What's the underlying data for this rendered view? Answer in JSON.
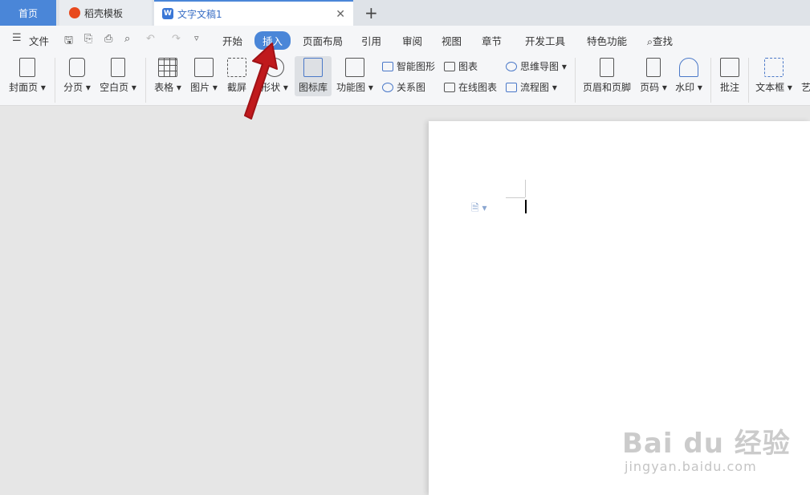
{
  "tabs": {
    "home": "首页",
    "daoke": "稻壳模板",
    "doc": "文字文稿1",
    "doc_icon": "W"
  },
  "menu": {
    "file": "文件",
    "items": [
      "开始",
      "插入",
      "页面布局",
      "引用",
      "审阅",
      "视图",
      "章节",
      "开发工具",
      "特色功能"
    ],
    "search": "查找"
  },
  "ribbon": {
    "cover": "封面页",
    "pagebreak": "分页",
    "blankpage": "空白页",
    "table": "表格",
    "picture": "图片",
    "screenshot": "截屏",
    "shape": "形状",
    "iconlib": "图标库",
    "funcchart": "功能图",
    "smartart": "智能图形",
    "chart": "图表",
    "mindmap": "思维导图",
    "relation": "关系图",
    "onlinechart": "在线图表",
    "flowchart": "流程图",
    "headerfooter": "页眉和页脚",
    "pagenum": "页码",
    "watermark": "水印",
    "comment": "批注",
    "textbox": "文本框",
    "art": "艺"
  },
  "watermark": {
    "logo": "Bai du 经验",
    "url": "jingyan.baidu.com"
  },
  "colors": {
    "accent": "#4a86d8",
    "arrow": "#c0191c"
  }
}
